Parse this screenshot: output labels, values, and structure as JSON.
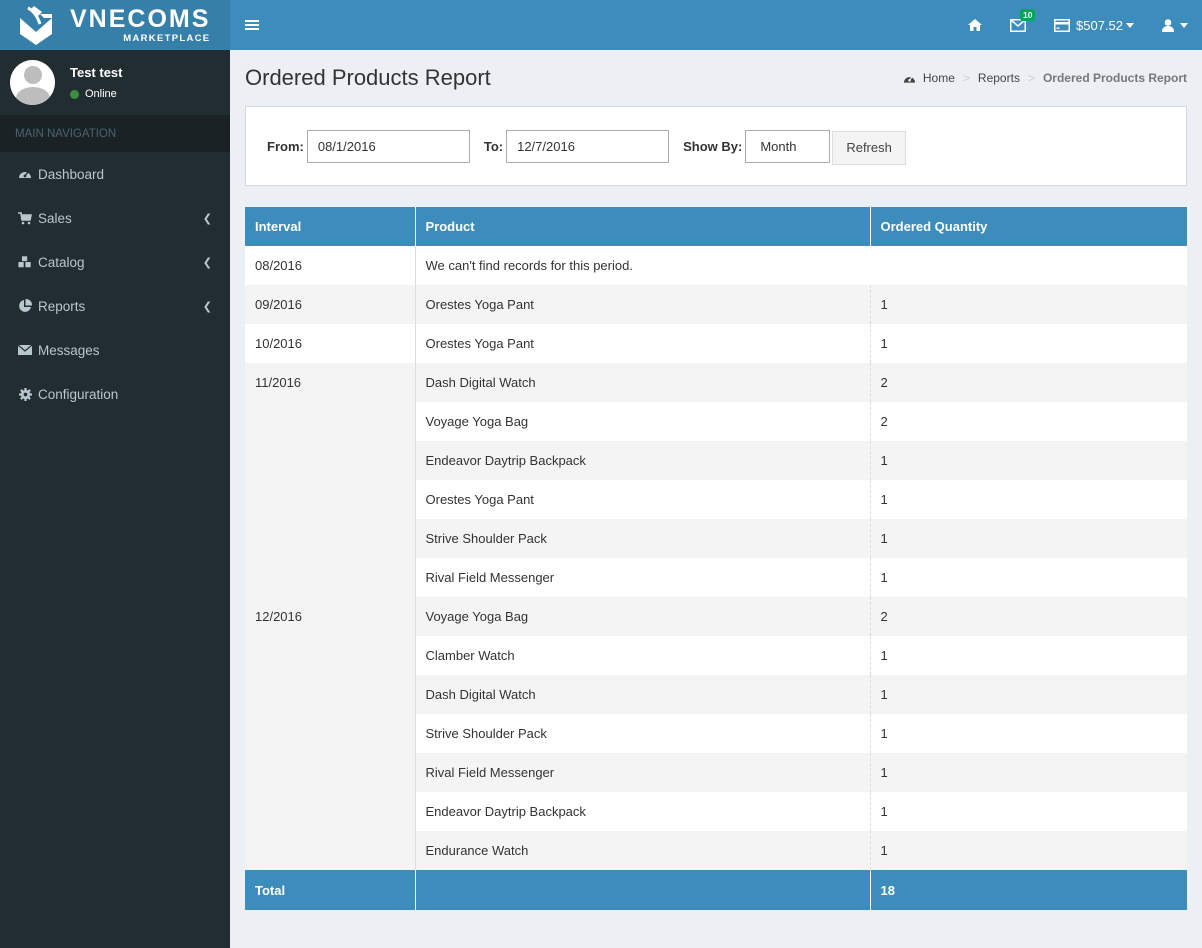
{
  "brand": {
    "name": "VNECOMS",
    "tagline": "MARKETPLACE"
  },
  "user": {
    "name": "Test test",
    "status": "Online",
    "status_color": "#3c8d3c"
  },
  "sidebar": {
    "header": "MAIN NAVIGATION",
    "items": [
      {
        "label": "Dashboard",
        "icon": "dashboard-icon",
        "has_submenu": false
      },
      {
        "label": "Sales",
        "icon": "cart-icon",
        "has_submenu": true
      },
      {
        "label": "Catalog",
        "icon": "cubes-icon",
        "has_submenu": true
      },
      {
        "label": "Reports",
        "icon": "pie-chart-icon",
        "has_submenu": true
      },
      {
        "label": "Messages",
        "icon": "envelope-icon",
        "has_submenu": false
      },
      {
        "label": "Configuration",
        "icon": "gear-icon",
        "has_submenu": false
      }
    ]
  },
  "topbar": {
    "messages_count": "10",
    "balance": "$507.52"
  },
  "page": {
    "title": "Ordered Products Report",
    "breadcrumb": [
      {
        "label": "Home"
      },
      {
        "label": "Reports"
      },
      {
        "label": "Ordered Products Report"
      }
    ]
  },
  "filter": {
    "from_label": "From:",
    "from_value": "08/1/2016",
    "to_label": "To:",
    "to_value": "12/7/2016",
    "showby_label": "Show By:",
    "showby_value": "Month",
    "refresh_label": "Refresh"
  },
  "table": {
    "headers": [
      "Interval",
      "Product",
      "Ordered Quantity"
    ],
    "groups": [
      {
        "interval": "08/2016",
        "empty_message": "We can't find records for this period.",
        "rows": []
      },
      {
        "interval": "09/2016",
        "rows": [
          {
            "product": "Orestes Yoga Pant",
            "qty": "1"
          }
        ]
      },
      {
        "interval": "10/2016",
        "rows": [
          {
            "product": "Orestes Yoga Pant",
            "qty": "1"
          }
        ]
      },
      {
        "interval": "11/2016",
        "rows": [
          {
            "product": "Dash Digital Watch",
            "qty": "2"
          },
          {
            "product": "Voyage Yoga Bag",
            "qty": "2"
          },
          {
            "product": "Endeavor Daytrip Backpack",
            "qty": "1"
          },
          {
            "product": "Orestes Yoga Pant",
            "qty": "1"
          },
          {
            "product": "Strive Shoulder Pack",
            "qty": "1"
          },
          {
            "product": "Rival Field Messenger",
            "qty": "1"
          }
        ]
      },
      {
        "interval": "12/2016",
        "rows": [
          {
            "product": "Voyage Yoga Bag",
            "qty": "2"
          },
          {
            "product": "Clamber Watch",
            "qty": "1"
          },
          {
            "product": "Dash Digital Watch",
            "qty": "1"
          },
          {
            "product": "Strive Shoulder Pack",
            "qty": "1"
          },
          {
            "product": "Rival Field Messenger",
            "qty": "1"
          },
          {
            "product": "Endeavor Daytrip Backpack",
            "qty": "1"
          },
          {
            "product": "Endurance Watch",
            "qty": "1"
          }
        ]
      }
    ],
    "footer": {
      "label": "Total",
      "product": "",
      "total": "18"
    }
  },
  "colors": {
    "primary": "#3c8dbc",
    "logo_bg": "#367fa9",
    "sidebar_bg": "#222d32",
    "badge": "#00a65a"
  }
}
